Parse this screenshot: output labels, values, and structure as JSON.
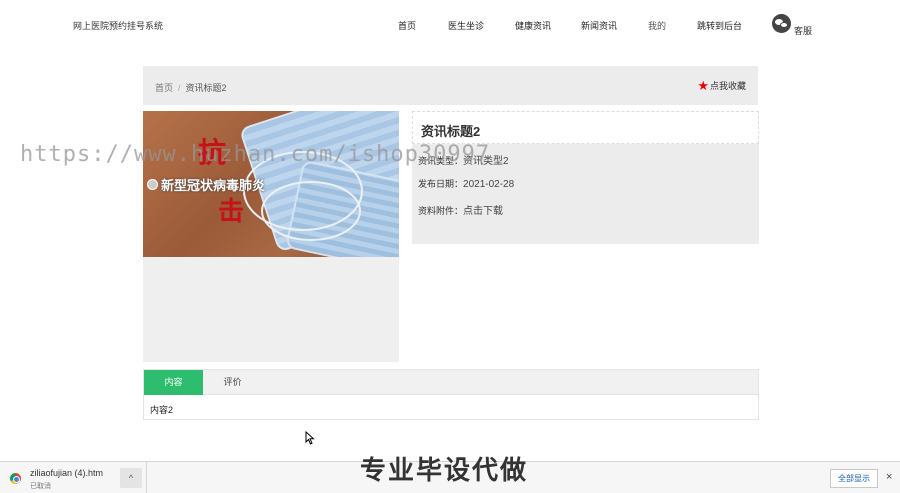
{
  "header": {
    "site_title": "网上医院预约挂号系统",
    "nav": [
      "首页",
      "医生坐诊",
      "健康资讯",
      "新闻资讯",
      "我的",
      "跳转到后台"
    ],
    "service_label": "客服"
  },
  "breadcrumb": {
    "home": "首页",
    "separator": "/",
    "current": "资讯标题2",
    "favorite_label": "点我收藏"
  },
  "photo": {
    "calligraphy_top": "抗",
    "calligraphy_bottom": "击",
    "caption": "新型冠状病毒肺炎"
  },
  "info": {
    "title": "资讯标题2",
    "type_label": "资讯类型：",
    "type_value": "资讯类型2",
    "date_label": "发布日期：",
    "date_value": "2021-02-28",
    "attachment_label": "资料附件：",
    "attachment_value": "点击下载"
  },
  "tabs": {
    "items": [
      "内容",
      "评价"
    ],
    "active_index": 0,
    "content": "内容2"
  },
  "watermark": "https://www.huzhan.com/ishop30997",
  "download_bar": {
    "file_name": "ziliaofujian (4).htm",
    "status": "已取消",
    "promo_text": "专业毕设代做",
    "show_all_label": "全部显示",
    "close_symbol": "×",
    "chevron_symbol": "^"
  },
  "colors": {
    "active_tab": "#2ebd6f",
    "favorite_star": "#e00000",
    "panel_bg": "#ececec"
  }
}
